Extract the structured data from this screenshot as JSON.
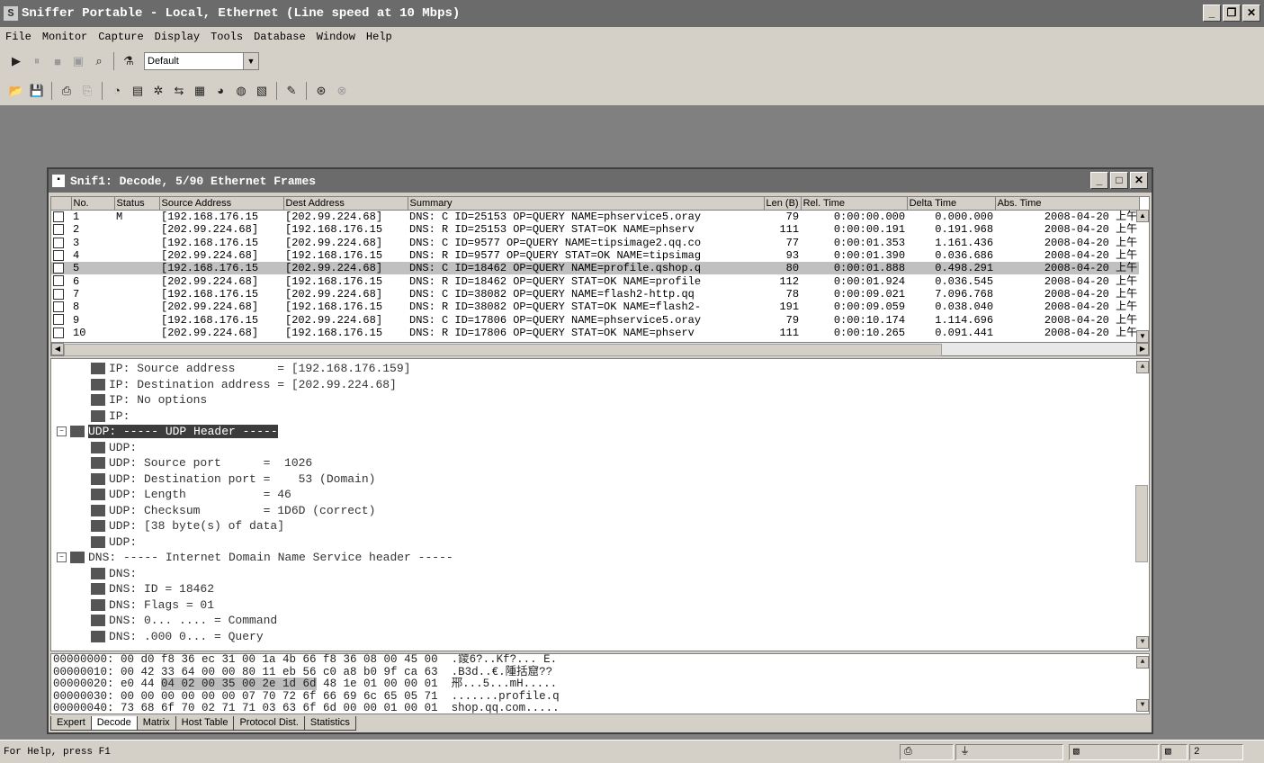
{
  "app": {
    "title": "Sniffer Portable - Local, Ethernet (Line speed at 10 Mbps)"
  },
  "menu": [
    "File",
    "Monitor",
    "Capture",
    "Display",
    "Tools",
    "Database",
    "Window",
    "Help"
  ],
  "toolbar": {
    "profile_value": "Default"
  },
  "decode_window": {
    "title": "Snif1: Decode, 5/90 Ethernet Frames",
    "columns": [
      "No.",
      "Status",
      "Source Address",
      "Dest Address",
      "Summary",
      "Len (B)",
      "Rel. Time",
      "Delta Time",
      "Abs. Time"
    ],
    "rows": [
      {
        "no": "1",
        "status": "M",
        "src": "[192.168.176.15",
        "dst": "[202.99.224.68]",
        "summary": "DNS: C ID=25153 OP=QUERY NAME=phservice5.oray",
        "len": "79",
        "rel": "0:00:00.000",
        "delta": "0.000.000",
        "abs": "2008-04-20 上午"
      },
      {
        "no": "2",
        "status": "",
        "src": "[202.99.224.68]",
        "dst": "[192.168.176.15",
        "summary": "DNS: R ID=25153 OP=QUERY STAT=OK NAME=phserv",
        "len": "111",
        "rel": "0:00:00.191",
        "delta": "0.191.968",
        "abs": "2008-04-20 上午"
      },
      {
        "no": "3",
        "status": "",
        "src": "[192.168.176.15",
        "dst": "[202.99.224.68]",
        "summary": "DNS: C ID=9577 OP=QUERY NAME=tipsimage2.qq.co",
        "len": "77",
        "rel": "0:00:01.353",
        "delta": "1.161.436",
        "abs": "2008-04-20 上午"
      },
      {
        "no": "4",
        "status": "",
        "src": "[202.99.224.68]",
        "dst": "[192.168.176.15",
        "summary": "DNS: R ID=9577 OP=QUERY STAT=OK NAME=tipsimag",
        "len": "93",
        "rel": "0:00:01.390",
        "delta": "0.036.686",
        "abs": "2008-04-20 上午"
      },
      {
        "no": "5",
        "status": "",
        "src": "[192.168.176.15",
        "dst": "[202.99.224.68]",
        "summary": "DNS: C ID=18462 OP=QUERY NAME=profile.qshop.q",
        "len": "80",
        "rel": "0:00:01.888",
        "delta": "0.498.291",
        "abs": "2008-04-20 上午",
        "selected": true
      },
      {
        "no": "6",
        "status": "",
        "src": "[202.99.224.68]",
        "dst": "[192.168.176.15",
        "summary": "DNS: R ID=18462 OP=QUERY STAT=OK NAME=profile",
        "len": "112",
        "rel": "0:00:01.924",
        "delta": "0.036.545",
        "abs": "2008-04-20 上午"
      },
      {
        "no": "7",
        "status": "",
        "src": "[192.168.176.15",
        "dst": "[202.99.224.68]",
        "summary": "DNS: C ID=38082 OP=QUERY NAME=flash2-http.qq",
        "len": "78",
        "rel": "0:00:09.021",
        "delta": "7.096.768",
        "abs": "2008-04-20 上午"
      },
      {
        "no": "8",
        "status": "",
        "src": "[202.99.224.68]",
        "dst": "[192.168.176.15",
        "summary": "DNS: R ID=38082 OP=QUERY STAT=OK NAME=flash2-",
        "len": "191",
        "rel": "0:00:09.059",
        "delta": "0.038.040",
        "abs": "2008-04-20 上午"
      },
      {
        "no": "9",
        "status": "",
        "src": "[192.168.176.15",
        "dst": "[202.99.224.68]",
        "summary": "DNS: C ID=17806 OP=QUERY NAME=phservice5.oray",
        "len": "79",
        "rel": "0:00:10.174",
        "delta": "1.114.696",
        "abs": "2008-04-20 上午"
      },
      {
        "no": "10",
        "status": "",
        "src": "[202.99.224.68]",
        "dst": "[192.168.176.15",
        "summary": "DNS: R ID=17806 OP=QUERY STAT=OK NAME=phserv",
        "len": "111",
        "rel": "0:00:10.265",
        "delta": "0.091.441",
        "abs": "2008-04-20 上午"
      }
    ],
    "decode_lines": [
      {
        "text": "IP: Source address      = [192.168.176.159]",
        "icon": "leaf"
      },
      {
        "text": "IP: Destination address = [202.99.224.68]",
        "icon": "leaf"
      },
      {
        "text": "IP: No options",
        "icon": "leaf"
      },
      {
        "text": "IP:",
        "icon": "leaf"
      },
      {
        "text": "UDP: ----- UDP Header -----",
        "icon": "group",
        "highlight": true
      },
      {
        "text": "UDP:",
        "icon": "leaf"
      },
      {
        "text": "UDP: Source port      =  1026",
        "icon": "leaf"
      },
      {
        "text": "UDP: Destination port =    53 (Domain)",
        "icon": "leaf"
      },
      {
        "text": "UDP: Length           = 46",
        "icon": "leaf"
      },
      {
        "text": "UDP: Checksum         = 1D6D (correct)",
        "icon": "leaf"
      },
      {
        "text": "UDP: [38 byte(s) of data]",
        "icon": "leaf"
      },
      {
        "text": "UDP:",
        "icon": "leaf"
      },
      {
        "text": "DNS: ----- Internet Domain Name Service header -----",
        "icon": "group"
      },
      {
        "text": "DNS:",
        "icon": "leaf"
      },
      {
        "text": "DNS: ID = 18462",
        "icon": "leaf"
      },
      {
        "text": "DNS: Flags = 01",
        "icon": "leaf"
      },
      {
        "text": "DNS: 0... .... = Command",
        "icon": "leaf"
      },
      {
        "text": "DNS: .000 0... = Query",
        "icon": "leaf"
      }
    ],
    "hex_rows": [
      {
        "pre": "00000000: 00 d0 f8 36 ec 31 00 1a 4b 66 f8 36 08 00 45 00 ",
        "hl": "",
        "post": "",
        "ascii": " .鑁6?..Kf?... E."
      },
      {
        "pre": "00000010: 00 42 33 64 00 00 80 11 eb 56 c0 a8 b0 9f ca 63 ",
        "hl": "",
        "post": "",
        "ascii": " .B3d..€.隀括窟??"
      },
      {
        "pre": "00000020: e0 44 ",
        "hl": "04 02 00 35 00 2e 1d 6d",
        "post": " 48 1e 01 00 00 01 ",
        "ascii": " 郉...5...mH....."
      },
      {
        "pre": "00000030: 00 00 00 00 00 00 07 70 72 6f 66 69 6c 65 05 71 ",
        "hl": "",
        "post": "",
        "ascii": " .......profile.q"
      },
      {
        "pre": "00000040: 73 68 6f 70 02 71 71 03 63 6f 6d 00 00 01 00 01 ",
        "hl": "",
        "post": "",
        "ascii": " shop.qq.com....."
      }
    ],
    "tabs": [
      "Expert",
      "Decode",
      "Matrix",
      "Host Table",
      "Protocol Dist.",
      "Statistics"
    ],
    "active_tab": "Decode"
  },
  "status": {
    "help_text": "For Help, press F1",
    "count": "2"
  }
}
